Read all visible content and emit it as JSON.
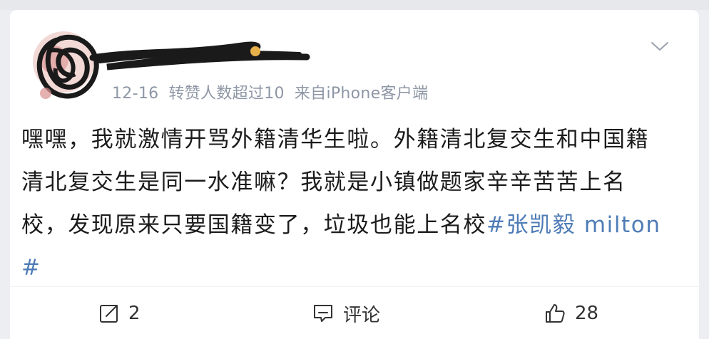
{
  "post": {
    "meta": {
      "date": "12-16",
      "visibility": "转赞人数超过10",
      "source": "来自iPhone客户端"
    },
    "text": "嘿嘿，我就激情开骂外籍清华生啦。外籍清北复交生和中国籍清北复交生是同一水准嘛？我就是小镇做题家辛辛苦苦上名校，发现原来只要国籍变了，垃圾也能上名校",
    "hashtag": "#张凯毅 milton#"
  },
  "actions": {
    "repost_count": "2",
    "comment_label": "评论",
    "like_count": "28"
  },
  "icons": {
    "more": "chevron-down-icon",
    "repost": "repost-icon",
    "comment": "comment-icon",
    "like": "thumbs-up-icon"
  },
  "colors": {
    "hashtag": "#4f7cb6",
    "meta": "#8e97a5",
    "text": "#1b1b1b",
    "background": "#eceef2"
  }
}
